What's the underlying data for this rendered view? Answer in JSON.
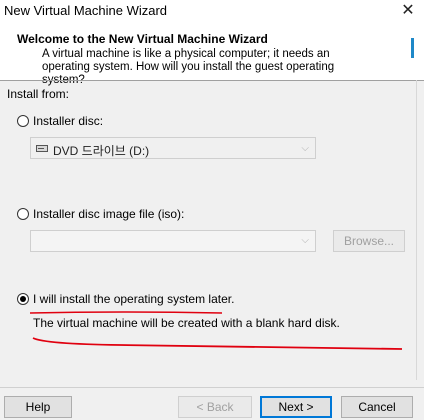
{
  "window": {
    "title": "New Virtual Machine Wizard"
  },
  "header": {
    "title": "Welcome to the New Virtual Machine Wizard",
    "description": "A virtual machine is like a physical computer; it needs an operating system. How will you install the guest operating system?"
  },
  "install_from": {
    "label": "Install from:",
    "options": [
      {
        "label": "Installer disc:",
        "selected": false
      },
      {
        "label": "Installer disc image file (iso):",
        "selected": false
      },
      {
        "label": "I will install the operating system later.",
        "selected": true
      }
    ],
    "disc_select": {
      "value": "DVD 드라이브 (D:)"
    },
    "iso": {
      "value": "",
      "browse_label": "Browse..."
    },
    "later_note": "The virtual machine will be created with a blank hard disk."
  },
  "footer": {
    "help": "Help",
    "back": "< Back",
    "next": "Next >",
    "cancel": "Cancel"
  },
  "colors": {
    "annotation": "#e0000f",
    "accent": "#0078d7"
  }
}
